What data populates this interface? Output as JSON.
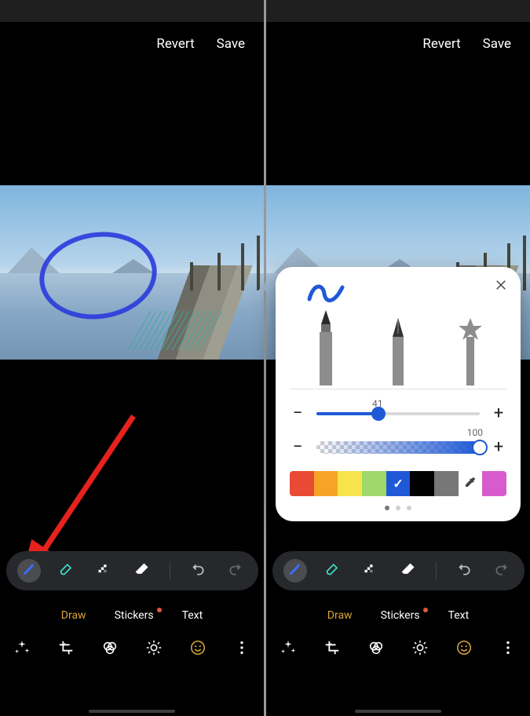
{
  "header": {
    "revert": "Revert",
    "save": "Save"
  },
  "tabs": {
    "draw": "Draw",
    "stickers": "Stickers",
    "text": "Text"
  },
  "tooltips": {
    "pen": "pen-tool",
    "marker": "marker-tool",
    "mosaic": "mosaic-tool",
    "eraser": "eraser-tool",
    "undo": "undo",
    "redo": "redo"
  },
  "bottom": {
    "auto": "auto-enhance",
    "crop": "crop-rotate",
    "filters": "filters",
    "adjust": "adjust",
    "emoji": "decorations",
    "more": "more-options"
  },
  "popup": {
    "size_value": 41,
    "opacity_value": 100,
    "size_pct": 38,
    "opacity_pct": 100,
    "colors": [
      {
        "hex": "#e94a35",
        "name": "red"
      },
      {
        "hex": "#f6a328",
        "name": "orange"
      },
      {
        "hex": "#f8e44a",
        "name": "yellow"
      },
      {
        "hex": "#9fd86b",
        "name": "green"
      },
      {
        "hex": "#1f59d6",
        "name": "blue",
        "selected": true
      },
      {
        "hex": "#000000",
        "name": "black"
      },
      {
        "hex": "#777777",
        "name": "gray"
      },
      {
        "hex": "picker",
        "name": "eyedropper"
      },
      {
        "hex": "#d85bcd",
        "name": "magenta"
      }
    ],
    "pager": {
      "count": 3,
      "active": 0
    }
  }
}
